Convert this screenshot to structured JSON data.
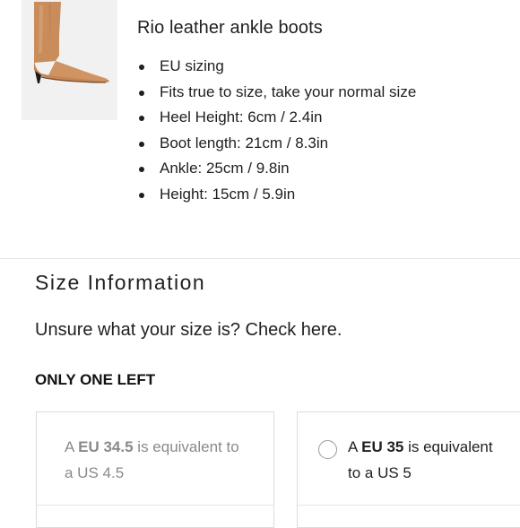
{
  "product": {
    "title": "Rio leather ankle boots",
    "image_alt": "Tan leather pointed-toe ankle boot with kitten heel",
    "specs": [
      "EU sizing",
      "Fits true to size, take your normal size",
      "Heel Height: 6cm / 2.4in",
      "Boot length: 21cm / 8.3in",
      "Ankle: 25cm / 9.8in",
      "Height: 15cm / 5.9in"
    ]
  },
  "size_info": {
    "title": "Size Information",
    "help_link": "Unsure what your size is? Check here.",
    "stock_notice": "ONLY ONE LEFT",
    "options": [
      {
        "prefix": "A ",
        "size": "EU 34.5",
        "mid": " is equivalent to",
        "us": "a US 4.5",
        "available": false
      },
      {
        "prefix": "A ",
        "size": "EU 35",
        "mid": " is equivalent",
        "us": "to a US 5",
        "available": true
      }
    ]
  },
  "colors": {
    "boot_leather": "#c98d5c",
    "heel": "#1a1a1a",
    "unavailable_text": "#8a8a8a"
  }
}
